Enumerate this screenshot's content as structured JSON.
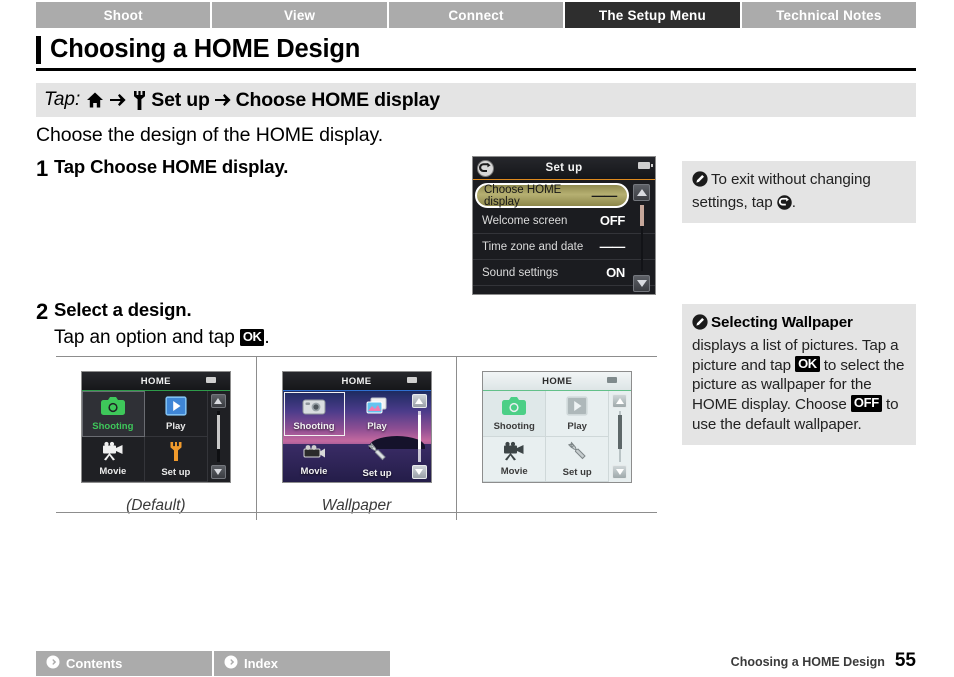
{
  "tabs": [
    {
      "label": "Shoot",
      "active": false
    },
    {
      "label": "View",
      "active": false
    },
    {
      "label": "Connect",
      "active": false
    },
    {
      "label": "The Setup Menu",
      "active": true
    },
    {
      "label": "Technical Notes",
      "active": false
    }
  ],
  "page_title": "Choosing a HOME Design",
  "tap_path": {
    "label": "Tap:",
    "home_icon": "home-icon",
    "arrow1": "→",
    "wrench_icon": "wrench-icon",
    "setup": "Set up",
    "arrow2": "→",
    "target": "Choose HOME display"
  },
  "intro": "Choose the design of the HOME display.",
  "steps": [
    {
      "num": "1",
      "heading_prefix": "Tap ",
      "heading_bold": "Choose HOME display",
      "heading_suffix": "."
    },
    {
      "num": "2",
      "heading": "Select a design.",
      "sub_prefix": "Tap an option and tap ",
      "sub_badge": "OK",
      "sub_suffix": "."
    }
  ],
  "lcd_menu": {
    "title": "Set up",
    "back_icon": "back-arrow-icon",
    "battery_icon": "battery-icon",
    "scroll_up_icon": "scroll-up-icon",
    "scroll_down_icon": "scroll-down-icon",
    "rows": [
      {
        "label": "Choose HOME display",
        "value": "——",
        "selected": true
      },
      {
        "label": "Welcome screen",
        "value": "OFF",
        "selected": false
      },
      {
        "label": "Time zone and date",
        "value": "——",
        "selected": false
      },
      {
        "label": "Sound settings",
        "value": "ON",
        "selected": false
      }
    ]
  },
  "notes": [
    {
      "icon": "pencil-note-icon",
      "segments": [
        {
          "type": "text",
          "text": "To exit without changing settings, tap "
        },
        {
          "type": "glyph",
          "text": "back-arrow-icon"
        },
        {
          "type": "text",
          "text": "."
        }
      ],
      "plain": "To exit without changing settings, tap ."
    },
    {
      "icon": "pencil-note-icon",
      "bold_lead": "Selecting Wallpaper",
      "text_1": " displays a list of pictures. Tap a picture and tap ",
      "badge_1": "OK",
      "text_2": " to select the picture as wallpaper for the HOME display. Choose ",
      "badge_2": "OFF",
      "text_3": " to use the default wallpaper."
    }
  ],
  "designs": {
    "cells": [
      {
        "theme": "dark",
        "caption": "(Default)",
        "bar_title": "HOME",
        "tiles": [
          {
            "label": "Shooting",
            "icon": "camera-icon",
            "selected": true
          },
          {
            "label": "Play",
            "icon": "play-icon",
            "selected": false
          },
          {
            "label": "Movie",
            "icon": "movie-camera-icon",
            "selected": false
          },
          {
            "label": "Set up",
            "icon": "wrench-icon",
            "selected": false
          }
        ]
      },
      {
        "theme": "wall",
        "caption": "Wallpaper",
        "bar_title": "HOME",
        "tiles": [
          {
            "label": "Shooting",
            "icon": "camera-icon",
            "selected": true
          },
          {
            "label": "Play",
            "icon": "play-icon",
            "selected": false
          },
          {
            "label": "Movie",
            "icon": "movie-camera-icon",
            "selected": false
          },
          {
            "label": "Set up",
            "icon": "wrench-icon",
            "selected": false
          }
        ]
      },
      {
        "theme": "light",
        "caption": "",
        "bar_title": "HOME",
        "tiles": [
          {
            "label": "Shooting",
            "icon": "camera-icon",
            "selected": true
          },
          {
            "label": "Play",
            "icon": "play-icon",
            "selected": false
          },
          {
            "label": "Movie",
            "icon": "movie-camera-icon",
            "selected": false
          },
          {
            "label": "Set up",
            "icon": "wrench-icon",
            "selected": false
          }
        ]
      }
    ]
  },
  "footer": {
    "contents_label": "Contents",
    "index_label": "Index",
    "contents_icon": "arrow-circle-icon",
    "index_icon": "arrow-circle-icon",
    "chapter": "Choosing a HOME Design",
    "page_number": "55"
  },
  "colors": {
    "tab_inactive": "#ababab",
    "tab_active": "#2e2e2e",
    "band": "#e4e4e4",
    "accent_orange": "#e08a1e",
    "accent_green": "#2e9b4a",
    "selected_row": "#b6b072"
  }
}
